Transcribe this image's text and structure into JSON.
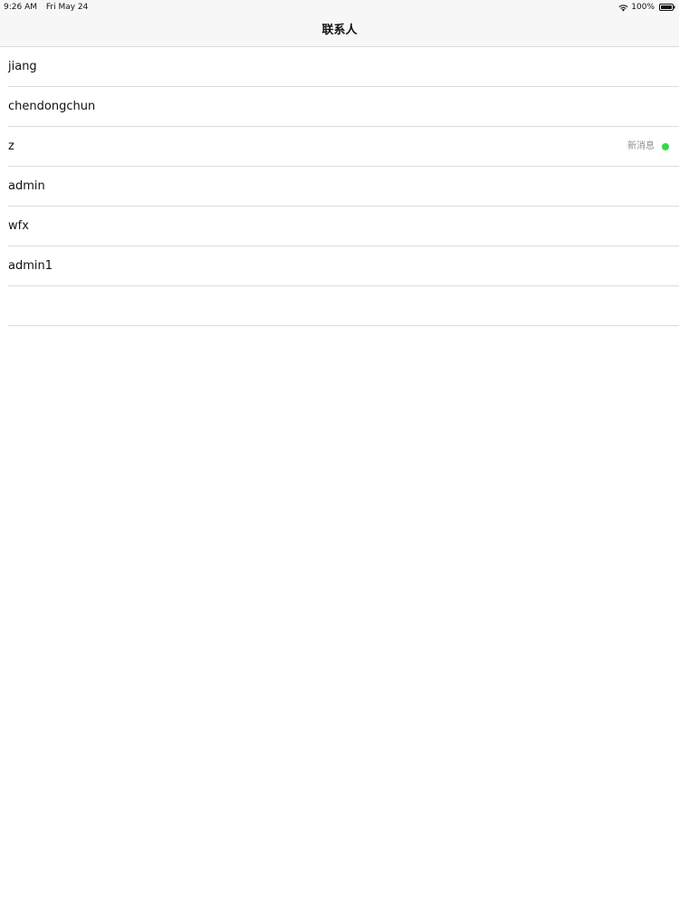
{
  "status_bar": {
    "time": "9:26 AM",
    "date": "Fri May 24",
    "battery": "100%",
    "wifi_icon": "wifi-icon",
    "battery_icon": "battery-icon"
  },
  "navigation": {
    "title": "联系人"
  },
  "contacts": [
    {
      "name": "jiang",
      "message_label": ""
    },
    {
      "name": "chendongchun",
      "message_label": ""
    },
    {
      "name": "z",
      "message_label": "新消息",
      "indicator": "new-message-dot",
      "indicator_color": "#35d84a"
    },
    {
      "name": "admin",
      "message_label": ""
    },
    {
      "name": "wfx",
      "message_label": ""
    },
    {
      "name": "admin1",
      "message_label": ""
    },
    {
      "name": "",
      "message_label": ""
    }
  ],
  "colors": {
    "separator": "#dcdcdf",
    "secondary_text": "#8e8e93",
    "online_indicator": "#35d84a",
    "bar_background": "#f7f7f8"
  }
}
